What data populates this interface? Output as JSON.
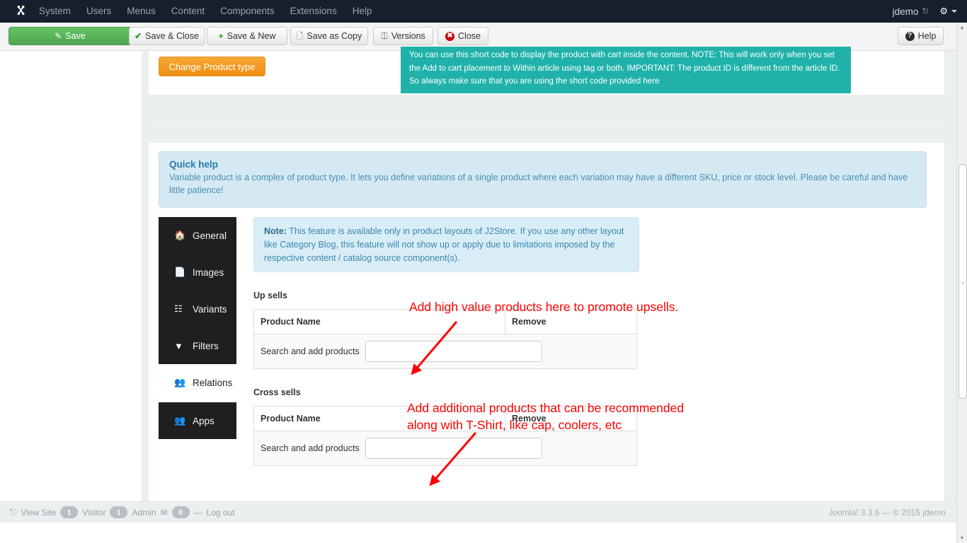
{
  "navbar": {
    "logo_icon": "joomla-logo-icon",
    "items": [
      {
        "label": "System"
      },
      {
        "label": "Users"
      },
      {
        "label": "Menus"
      },
      {
        "label": "Content"
      },
      {
        "label": "Components"
      },
      {
        "label": "Extensions"
      },
      {
        "label": "Help"
      }
    ],
    "user": "jdemo",
    "external_link_icon": "external-link-icon",
    "gear_icon": "gear-icon"
  },
  "toolbar": {
    "save": "Save",
    "save_close": "Save & Close",
    "save_new": "Save & New",
    "save_copy": "Save as Copy",
    "versions": "Versions",
    "close": "Close",
    "help": "Help"
  },
  "top_panel": {
    "change_product_type": "Change Product type",
    "shortcode_note": "You can use this short code to display the product with cart inside the content. NOTE: This will work only when you set the Add to cart placement to Within article using tag or both. IMPORTANT: The product ID is different from the article ID. So always make sure that you are using the short code provided here",
    "note_bg": "#20b2aa"
  },
  "quick_help": {
    "title": "Quick help",
    "text": "Variable product is a complex of product type. It lets you define variations of a single product where each variation may have a different SKU, price or stock level. Please be careful and have little patience!"
  },
  "tabs": [
    {
      "label": "General",
      "icon": "home-icon",
      "active": false
    },
    {
      "label": "Images",
      "icon": "image-file-icon",
      "active": false
    },
    {
      "label": "Variants",
      "icon": "sitemap-icon",
      "active": false
    },
    {
      "label": "Filters",
      "icon": "filter-icon",
      "active": false
    },
    {
      "label": "Relations",
      "icon": "users-icon",
      "active": true
    },
    {
      "label": "Apps",
      "icon": "users-icon",
      "active": false
    }
  ],
  "pane": {
    "note_label": "Note:",
    "note_text": " This feature is available only in product layouts of J2Store. If you use any other layout like Category Blog, this feature will not show up or apply due to limitations imposed by the respective content / catalog source component(s).",
    "upsells": {
      "title": "Up sells",
      "col_product": "Product Name",
      "col_remove": "Remove",
      "row_label": "Search and add products",
      "input_value": "",
      "input_placeholder": ""
    },
    "crosssells": {
      "title": "Cross sells",
      "col_product": "Product Name",
      "col_remove": "Remove",
      "row_label": "Search and add products",
      "input_value": "",
      "input_placeholder": ""
    }
  },
  "annotations": {
    "color": "#ff0000",
    "upsell_text": "Add high value products here to promote upsells.",
    "crosssell_line1": "Add additional products that can be recommended",
    "crosssell_line2": "along with T-Shirt, like cap, coolers, etc"
  },
  "footer": {
    "view_site": "View Site",
    "visitor_count": "1",
    "visitor_label": "Visitor",
    "admin_count": "1",
    "admin_label": "Admin",
    "message_icon": "envelope-icon",
    "message_count": "0",
    "log_out": "Log out",
    "copyright": "Joomla! 3.3.6  —  © 2015 jdemo"
  }
}
